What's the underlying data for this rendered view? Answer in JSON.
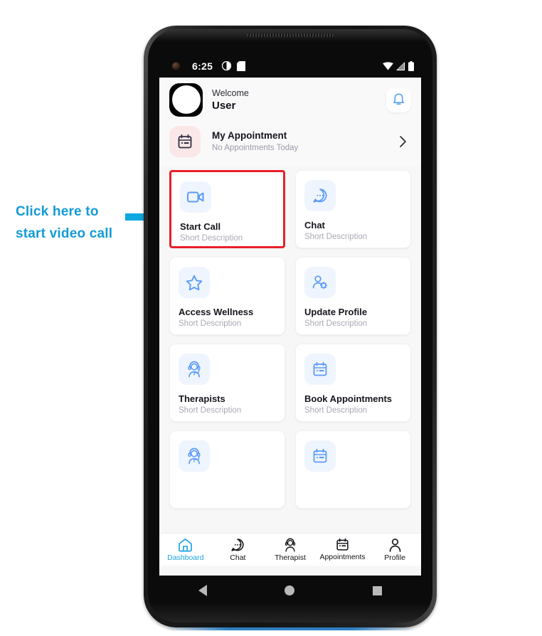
{
  "annotation": {
    "line1": "Click here to",
    "line2": "start video call",
    "color": "#139BD6",
    "arrow_icon": "right-arrow-icon"
  },
  "statusbar": {
    "time": "6:25",
    "icons": [
      "clock-icon",
      "sd-card-icon",
      "wifi-icon",
      "signal-icon",
      "battery-icon"
    ]
  },
  "header": {
    "welcome_label": "Welcome",
    "user_name": "User",
    "avatar_icon": "avatar",
    "notification_icon": "bell-icon"
  },
  "appointment": {
    "icon": "calendar-icon",
    "title": "My Appointment",
    "subtitle": "No Appointments Today",
    "chevron_icon": "chevron-right-icon",
    "icon_bg": "#FBE7E7"
  },
  "grid": {
    "card_icon_bg": "#EFF5FE",
    "accent": "#5B9BF8",
    "highlight_color": "#E8202A",
    "cards": [
      {
        "icon": "video-camera-icon",
        "title": "Start Call",
        "subtitle": "Short Description",
        "highlighted": true
      },
      {
        "icon": "chat-bubble-icon",
        "title": "Chat",
        "subtitle": "Short Description",
        "highlighted": false
      },
      {
        "icon": "star-icon",
        "title": "Access Wellness",
        "subtitle": "Short Description",
        "highlighted": false
      },
      {
        "icon": "user-gear-icon",
        "title": "Update Profile",
        "subtitle": "Short Description",
        "highlighted": false
      },
      {
        "icon": "therapist-icon",
        "title": "Therapists",
        "subtitle": "Short Description",
        "highlighted": false
      },
      {
        "icon": "calendar-icon",
        "title": "Book Appointments",
        "subtitle": "Short Description",
        "highlighted": false
      },
      {
        "icon": "therapist-icon",
        "title": "",
        "subtitle": "",
        "highlighted": false
      },
      {
        "icon": "calendar-icon",
        "title": "",
        "subtitle": "",
        "highlighted": false
      }
    ]
  },
  "bottom_nav": {
    "active_color": "#1CA4E0",
    "items": [
      {
        "icon": "home-icon",
        "label": "Dashboard",
        "active": true
      },
      {
        "icon": "chat-bubble-icon",
        "label": "Chat",
        "active": false
      },
      {
        "icon": "therapist-icon",
        "label": "Therapist",
        "active": false
      },
      {
        "icon": "calendar-icon",
        "label": "Appointments",
        "active": false
      },
      {
        "icon": "person-icon",
        "label": "Profile",
        "active": false
      }
    ]
  },
  "android_nav": {
    "back_icon": "back-triangle-icon",
    "home_icon": "home-circle-icon",
    "recents_icon": "recents-square-icon"
  }
}
